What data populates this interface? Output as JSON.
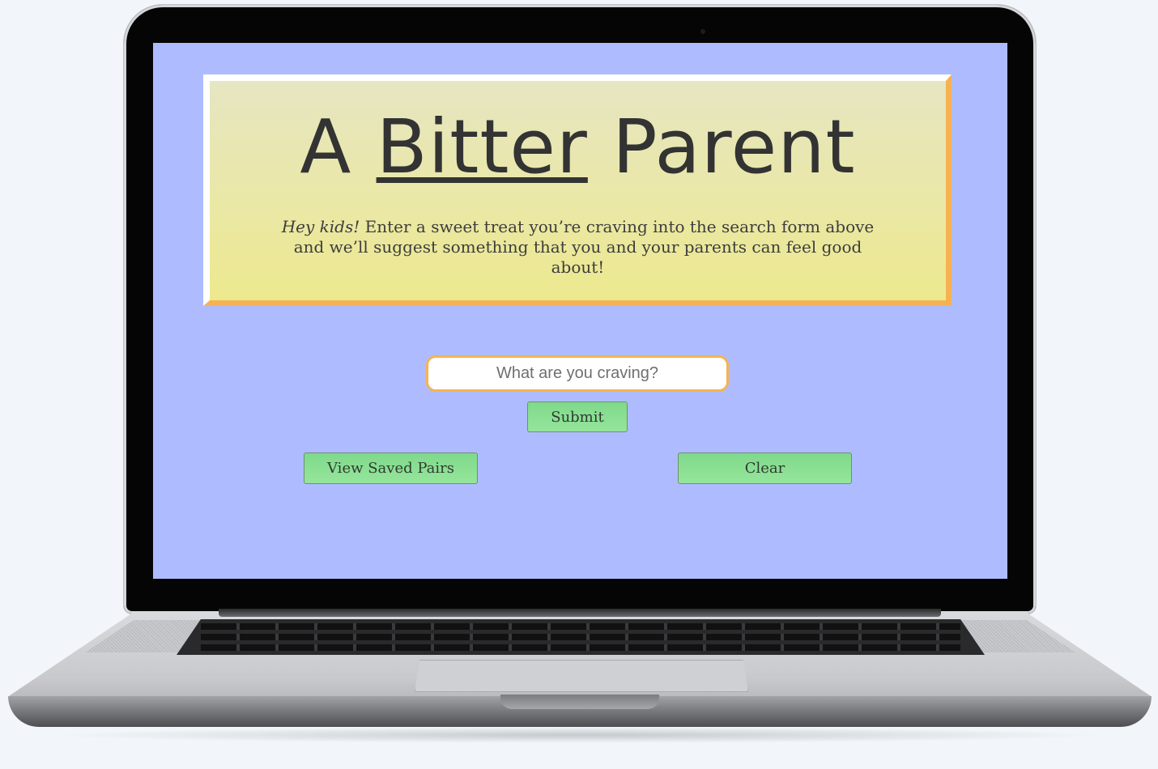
{
  "app": {
    "title_prefix": "A ",
    "title_emphasis": "Bitter",
    "title_suffix": " Parent"
  },
  "hero": {
    "intro_italic": "Hey kids!",
    "intro_text": " Enter a sweet treat you’re craving into the search form above and we’ll suggest something that you and your parents can feel good about!"
  },
  "search": {
    "value": "",
    "placeholder": "What are you craving?"
  },
  "buttons": {
    "submit_label": "Submit",
    "saved_label": "View Saved Pairs",
    "clear_label": "Clear"
  },
  "colors": {
    "page_background": "#aebcff",
    "hero_border_light": "#ffffff",
    "hero_border_accent": "#f6b252",
    "button_green": "#8be095",
    "title_text": "#333333"
  }
}
